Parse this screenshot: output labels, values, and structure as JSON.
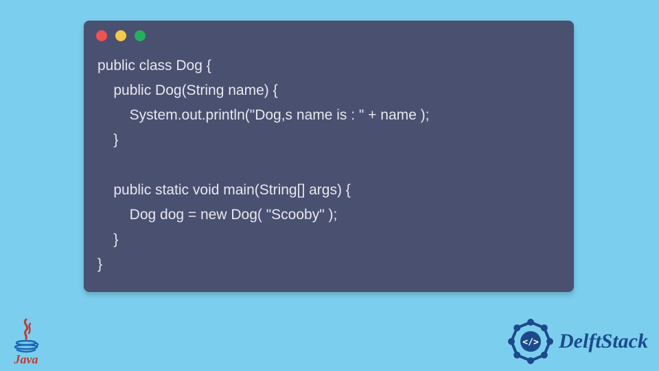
{
  "code": {
    "lines": [
      "public class Dog {",
      "    public Dog(String name) {",
      "        System.out.println(\"Dog,s name is : \" + name );",
      "    }",
      "",
      "    public static void main(String[] args) {",
      "        Dog dog = new Dog( \"Scooby\" );",
      "    }",
      "}"
    ]
  },
  "window": {
    "dots": [
      "red",
      "yellow",
      "green"
    ]
  },
  "logos": {
    "java": "Java",
    "delftstack": "DelftStack"
  },
  "colors": {
    "background": "#7cceee",
    "window": "#4a5070",
    "code_text": "#e8e8f0",
    "java_red": "#c13a2e",
    "delft_blue": "#1b4a8a"
  }
}
